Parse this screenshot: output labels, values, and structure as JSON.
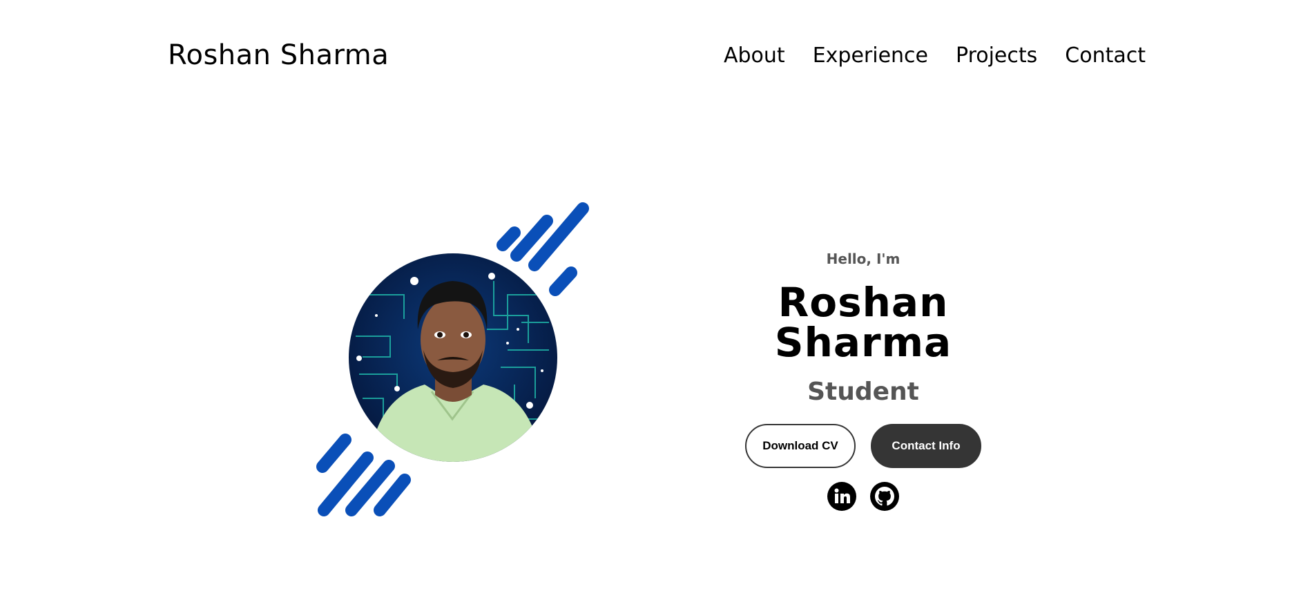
{
  "header": {
    "logo": "Roshan Sharma",
    "nav": [
      {
        "label": "About"
      },
      {
        "label": "Experience"
      },
      {
        "label": "Projects"
      },
      {
        "label": "Contact"
      }
    ]
  },
  "hero": {
    "greeting": "Hello, I'm",
    "name": "Roshan Sharma",
    "role": "Student",
    "buttons": {
      "download_cv": "Download CV",
      "contact_info": "Contact Info"
    },
    "socials": [
      {
        "icon": "linkedin-icon"
      },
      {
        "icon": "github-icon"
      }
    ],
    "colors": {
      "accent_blue": "#0a4fb8",
      "dark_button": "#353535",
      "subtext": "#555555"
    }
  }
}
